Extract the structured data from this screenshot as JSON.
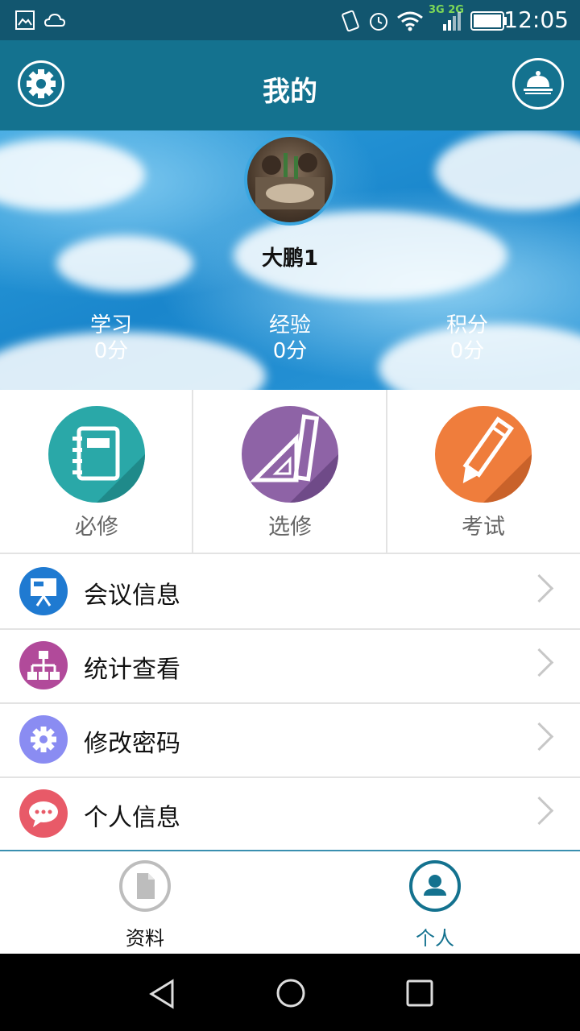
{
  "status_bar": {
    "time": "12:05",
    "network": "3G 2G"
  },
  "header": {
    "title": "我的",
    "left_icon": "settings-icon",
    "right_icon": "bell-icon"
  },
  "profile": {
    "name": "大鹏1",
    "stats": [
      {
        "label": "学习",
        "value": "0分"
      },
      {
        "label": "经验",
        "value": "0分"
      },
      {
        "label": "积分",
        "value": "0分"
      }
    ]
  },
  "features": [
    {
      "label": "必修",
      "icon": "notebook-icon",
      "color": "#2aa8a8"
    },
    {
      "label": "选修",
      "icon": "ruler-triangle-icon",
      "color": "#8e63a6"
    },
    {
      "label": "考试",
      "icon": "pencil-icon",
      "color": "#ef7d3c"
    }
  ],
  "menu": [
    {
      "label": "会议信息",
      "icon": "presentation-icon",
      "color": "#1f7ad1"
    },
    {
      "label": "统计查看",
      "icon": "org-chart-icon",
      "color": "#b14a9a"
    },
    {
      "label": "修改密码",
      "icon": "gear-icon",
      "color": "#8a8cf2"
    },
    {
      "label": "个人信息",
      "icon": "chat-bubble-icon",
      "color": "#e85a68"
    }
  ],
  "tabs": [
    {
      "label": "资料",
      "icon": "document-icon",
      "active": false
    },
    {
      "label": "个人",
      "icon": "person-icon",
      "active": true
    }
  ],
  "colors": {
    "header": "#14728f",
    "status": "#12566f",
    "active_tab": "#14728f"
  }
}
